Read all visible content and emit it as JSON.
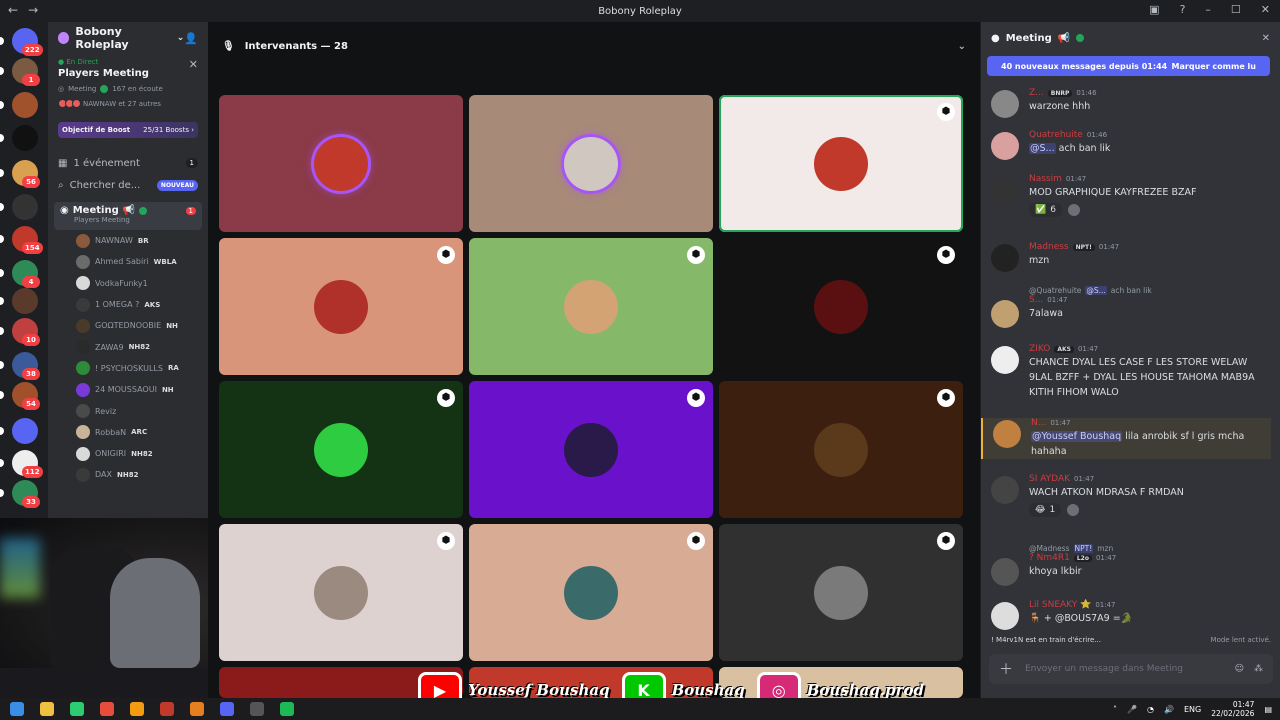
{
  "window": {
    "title": "Bobony Roleplay",
    "back": "←",
    "forward": "→"
  },
  "server": {
    "name": "Bobony Roleplay"
  },
  "live": {
    "label": "En Direct",
    "title": "Players Meeting",
    "channel": "Meeting",
    "listeners": "167 en écoute",
    "who": "NAWNAW et 27 autres"
  },
  "boost": {
    "label": "Objectif de Boost",
    "count": "25/31 Boosts"
  },
  "events": {
    "label": "1 événement",
    "count": "1"
  },
  "search": {
    "label": "Chercher de...",
    "badge": "NOUVEAU"
  },
  "meeting_channel": {
    "name": "Meeting",
    "status": "Players Meeting",
    "badge": "1"
  },
  "guild_badges": [
    "222",
    "1",
    "56",
    "154",
    "4",
    "10",
    "38",
    "54",
    "112",
    "33"
  ],
  "members": [
    {
      "name": "NAWNAW",
      "tag": "BR",
      "color": "#8b5a3c"
    },
    {
      "name": "Ahmed Sabiri",
      "tag": "WBLA",
      "color": "#6b6b6b"
    },
    {
      "name": "VodkaFunky1",
      "tag": "",
      "color": "#d9d9d9"
    },
    {
      "name": "1 OMEGA ?",
      "tag": "AKS",
      "color": "#3a3a3a"
    },
    {
      "name": "GOΩTEDNOOBIE",
      "tag": "NH",
      "color": "#4a3a2a"
    },
    {
      "name": "ZAWA9",
      "tag": "NH82",
      "color": "#2a2a2a"
    },
    {
      "name": "! PSYCHOSKULLS",
      "tag": "RA",
      "color": "#2e8b3a"
    },
    {
      "name": "24 MOUSSAOUI",
      "tag": "NH",
      "color": "#7a3ad9"
    },
    {
      "name": "Reviz",
      "tag": "",
      "color": "#4a4a4a"
    },
    {
      "name": "RobbaN",
      "tag": "ARC",
      "color": "#c9b49a"
    },
    {
      "name": "ONIGIRI",
      "tag": "NH82",
      "color": "#d9d9d9"
    },
    {
      "name": "DAX",
      "tag": "NH82",
      "color": "#3a3a3a"
    }
  ],
  "stage": {
    "header": "Intervenants — 28"
  },
  "tiles": [
    {
      "bg": "#8b3a48",
      "av": "#c0392b",
      "speak": true,
      "shield": false,
      "sel": false
    },
    {
      "bg": "#a88a78",
      "av": "#cfc7c0",
      "speak": true,
      "shield": false,
      "sel": false
    },
    {
      "bg": "#f2eae8",
      "av": "#c0392b",
      "speak": false,
      "shield": true,
      "sel": true
    },
    {
      "bg": "#d9957a",
      "av": "#b0302a",
      "speak": false,
      "shield": true,
      "sel": false
    },
    {
      "bg": "#86b86a",
      "av": "#d4a373",
      "speak": false,
      "shield": true,
      "sel": false
    },
    {
      "bg": "#121212",
      "av": "#5a1010",
      "speak": false,
      "shield": true,
      "sel": false
    },
    {
      "bg": "#143214",
      "av": "#2ecc40",
      "speak": false,
      "shield": true,
      "sel": false
    },
    {
      "bg": "#6a11cb",
      "av": "#2a1a4a",
      "speak": false,
      "shield": true,
      "sel": false
    },
    {
      "bg": "#3d1f10",
      "av": "#5a3a1a",
      "speak": false,
      "shield": true,
      "sel": false
    },
    {
      "bg": "#ddd2d0",
      "av": "#9a8a80",
      "speak": false,
      "shield": true,
      "sel": false
    },
    {
      "bg": "#d8ac94",
      "av": "#3a6a6a",
      "speak": false,
      "shield": true,
      "sel": false
    },
    {
      "bg": "#303030",
      "av": "#7a7a7a",
      "speak": false,
      "shield": true,
      "sel": false
    }
  ],
  "chat": {
    "title": "Meeting",
    "new_messages": "40 nouveaux messages depuis 01:44",
    "mark_read": "Marquer comme lu",
    "messages": [
      {
        "user": "Z...",
        "badge": "BNRP",
        "time": "01:46",
        "text": "warzone hhh",
        "av": "#888"
      },
      {
        "user": "Quatrehuite",
        "badge": "",
        "time": "01:46",
        "mention": "@S...",
        "text": "ach ban lik",
        "av": "#d9a0a0"
      },
      {
        "user": "Nassim",
        "badge": "",
        "time": "01:47",
        "text": "MOD GRAPHIQUE KAYFREZEE BZAF",
        "av": "#333",
        "react": "✅",
        "react_count": "6"
      },
      {
        "user": "Madness",
        "badge": "NPT!",
        "time": "01:47",
        "text": "mzn",
        "av": "#222"
      },
      {
        "user": "S...",
        "badge": "",
        "time": "01:47",
        "text": "7alawa",
        "av": "#c0a070",
        "reply_user": "@Quatrehuite",
        "reply_mention": "@S...",
        "reply_text": "ach ban lik"
      },
      {
        "user": "ZIKO",
        "badge": "AKS",
        "time": "01:47",
        "text": "CHANCE DYAL LES CASE F LES STORE WELAW 9LAL BZFF + DYAL LES HOUSE TAHOMA MAB9A KITIH FIHOM WALO",
        "av": "#eee"
      },
      {
        "user": "N...",
        "badge": "",
        "time": "01:47",
        "mention": "@Youssef Boushaq",
        "text": "lila anrobik sf l gris mcha hahaha",
        "av": "#c08040"
      },
      {
        "user": "SI AYDAK",
        "badge": "",
        "time": "01:47",
        "text": "WACH ATKON MDRASA F RMDAN",
        "av": "#444",
        "react": "😂",
        "react_count": "1"
      },
      {
        "user": "? Nm4R1",
        "badge": "L2o",
        "time": "01:47",
        "text": "khoya lkbir",
        "av": "#555",
        "reply_user": "@Madness",
        "reply_mention": "NPT!",
        "reply_text": "mzn"
      },
      {
        "user": "Lil SNEAKY ⭐",
        "badge": "",
        "time": "01:47",
        "text": "🪑 + @BOUS7A9 =🐊",
        "av": "#ddd"
      }
    ],
    "typing": "! M4rv1N est en train d'écrire...",
    "slow_mode": "Mode lent activé.",
    "input_placeholder": "Envoyer un message dans Meeting"
  },
  "social": [
    {
      "label": "Youssef Boushaq",
      "icon": "youtube-icon",
      "color": "#ff0000",
      "glyph": "▶"
    },
    {
      "label": "Boushaq",
      "icon": "kick-icon",
      "color": "#00c800",
      "glyph": "K"
    },
    {
      "label": "Boushaq.prod",
      "icon": "instagram-icon",
      "color": "#d62976",
      "glyph": "◎"
    }
  ],
  "tray": {
    "lang": "ENG",
    "time": "01:47",
    "date": "22/02/2026"
  }
}
